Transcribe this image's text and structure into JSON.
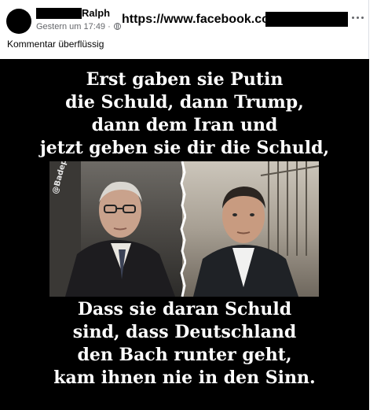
{
  "post": {
    "author_name": "Ralph",
    "timestamp": "Gestern um 17:49",
    "separator": "·",
    "globe_icon": "globe-icon",
    "url": "https://www.facebook.com/",
    "caption": "Kommentar überflüssig",
    "more_icon": "more-options-icon"
  },
  "meme": {
    "top_lines": [
      "Erst gaben sie Putin",
      "die Schuld, dann Trump,",
      "dann dem Iran und",
      "jetzt geben sie dir die Schuld,"
    ],
    "bottom_lines": [
      "Dass sie daran Schuld",
      "sind, dass Deutschland",
      "den Bach runter geht,",
      "kam ihnen nie in den Sinn."
    ],
    "watermark": "@Badepapst"
  },
  "colors": {
    "text_primary": "#050505",
    "text_secondary": "#65676b",
    "meme_background": "#000000",
    "meme_text": "#ffffff"
  }
}
